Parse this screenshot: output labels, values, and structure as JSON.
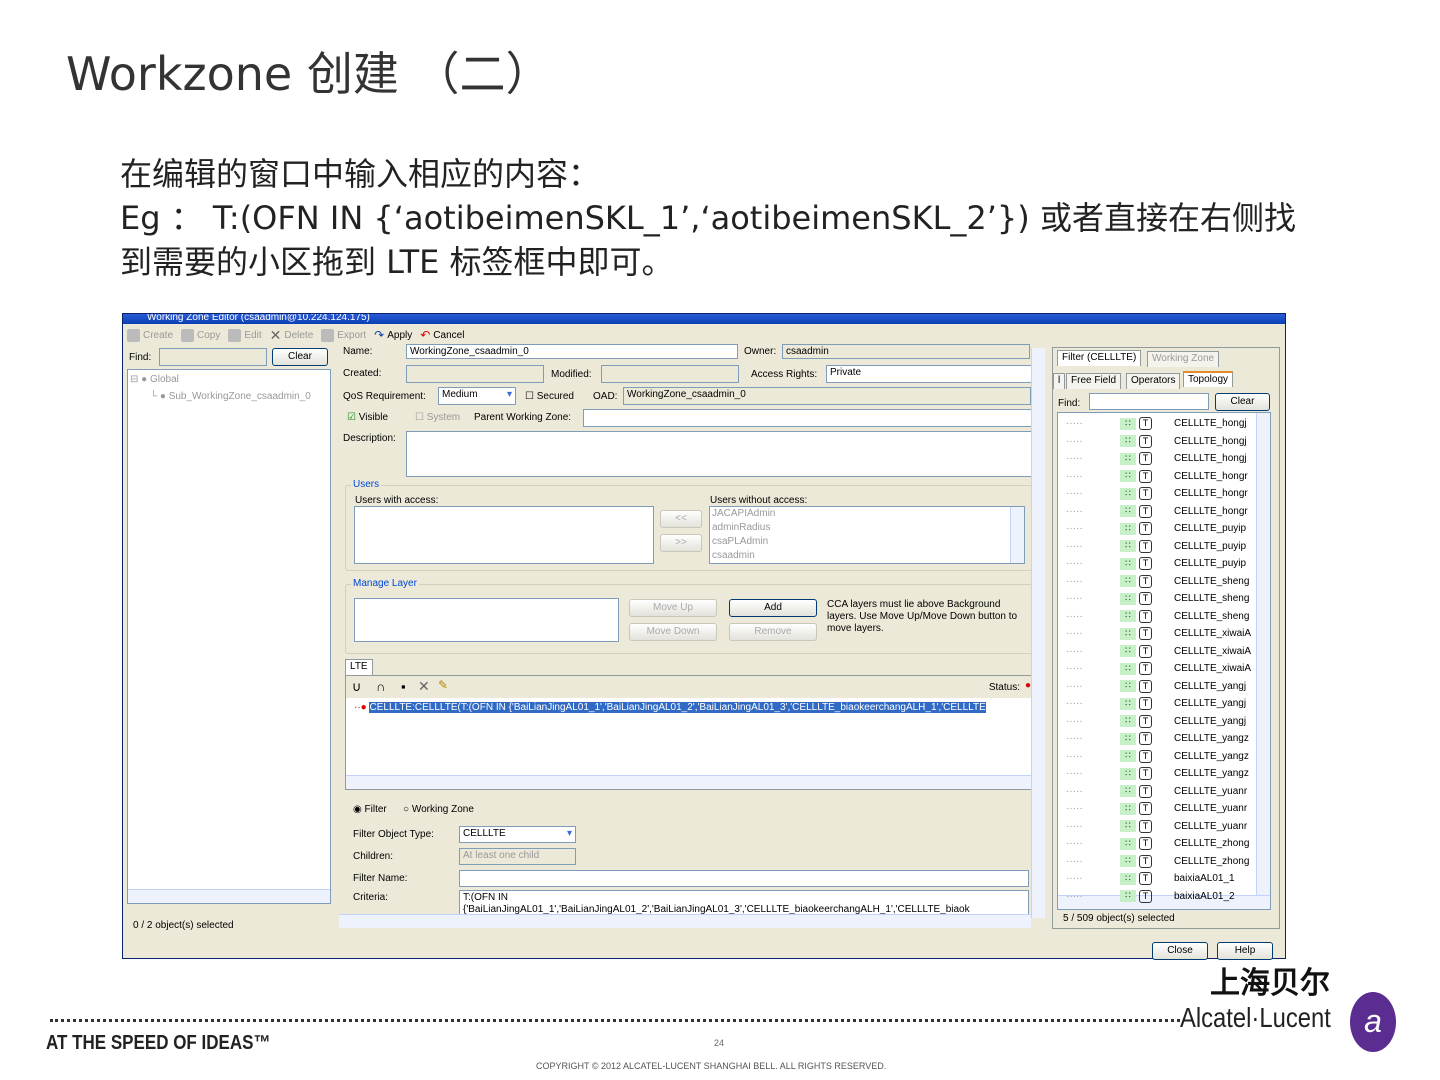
{
  "slide": {
    "title": "Workzone 创建 （二）",
    "lines": [
      "在编辑的窗口中输入相应的内容：",
      "Eg  ： T:(OFN IN {‘aotibeimenSKL_1’,‘aotibeimenSKL_2’}) 或者直接在右侧找",
      "到需要的小区拖到 LTE 标签框中即可。"
    ],
    "page_number": "24",
    "copyright": "COPYRIGHT © 2012 ALCATEL-LUCENT SHANGHAI BELL.  ALL RIGHTS RESERVED.",
    "tagline": "AT THE SPEED OF IDEAS™",
    "logo_cn": "上海贝尔",
    "logo_en": "Alcatel·Lucent"
  },
  "window": {
    "title": "Working Zone Editor (csaadmin@10.224.124.175)",
    "toolbar": [
      "Create",
      "Copy",
      "Edit",
      "Delete",
      "Export",
      "Apply",
      "Cancel"
    ],
    "left": {
      "find_label": "Find:",
      "clear": "Clear",
      "tree": [
        "Global",
        "Sub_WorkingZone_csaadmin_0"
      ],
      "status": "0 / 2 object(s) selected"
    },
    "form": {
      "name_label": "Name:",
      "name": "WorkingZone_csaadmin_0",
      "owner_label": "Owner:",
      "owner": "csaadmin",
      "created_label": "Created:",
      "modified_label": "Modified:",
      "access_label": "Access Rights:",
      "access": "Private",
      "qos_label": "QoS Requirement:",
      "qos": "Medium",
      "secured": "Secured",
      "oad_label": "OAD:",
      "oad": "WorkingZone_csaadmin_0",
      "visible": "Visible",
      "system": "System",
      "parent_label": "Parent Working Zone:",
      "desc_label": "Description:"
    },
    "users": {
      "title": "Users",
      "with": "Users with access:",
      "without": "Users without access:",
      "left_btn": "<<",
      "right_btn": ">>",
      "list": [
        "JACAPIAdmin",
        "adminRadius",
        "csaPLAdmin",
        "csaadmin"
      ]
    },
    "layer": {
      "title": "Manage Layer",
      "move_up": "Move Up",
      "move_down": "Move Down",
      "add": "Add",
      "remove": "Remove",
      "note": "CCA layers must lie above Background layers. Use Move Up/Move Down button to move layers."
    },
    "lte": {
      "tab": "LTE",
      "status": "Status:",
      "item": "CELLLTE:CELLLTE(T:(OFN IN {'BaiLianJingAL01_1','BaiLianJingAL01_2','BaiLianJingAL01_3','CELLLTE_biaokeerchangALH_1','CELLLTE"
    },
    "filter": {
      "radio_filter": "Filter",
      "radio_wz": "Working Zone",
      "type_label": "Filter Object Type:",
      "type": "CELLLTE",
      "children_label": "Children:",
      "children": "At least one child",
      "name_label": "Filter Name:",
      "criteria_label": "Criteria:",
      "criteria": "T:(OFN IN",
      "criteria2": "{'BaiLianJingAL01_1','BaiLianJingAL01_2','BaiLianJingAL01_3','CELLLTE_biaokeerchangALH_1','CELLLTE_biaok"
    },
    "right": {
      "tabs": [
        "Filter (CELLLTE)",
        "Working Zone"
      ],
      "subtabs": [
        "l",
        "Free Field",
        "Operators",
        "Topology"
      ],
      "find_label": "Find:",
      "clear": "Clear",
      "items": [
        "CELLLTE_hongj",
        "CELLLTE_hongj",
        "CELLLTE_hongj",
        "CELLLTE_hongr",
        "CELLLTE_hongr",
        "CELLLTE_hongr",
        "CELLLTE_puyip",
        "CELLLTE_puyip",
        "CELLLTE_puyip",
        "CELLLTE_sheng",
        "CELLLTE_sheng",
        "CELLLTE_sheng",
        "CELLLTE_xiwaiA",
        "CELLLTE_xiwaiA",
        "CELLLTE_xiwaiA",
        "CELLLTE_yangj",
        "CELLLTE_yangj",
        "CELLLTE_yangj",
        "CELLLTE_yangz",
        "CELLLTE_yangz",
        "CELLLTE_yangz",
        "CELLLTE_yuanr",
        "CELLLTE_yuanr",
        "CELLLTE_yuanr",
        "CELLLTE_zhong",
        "CELLLTE_zhong",
        "baixiaAL01_1",
        "baixiaAL01_2"
      ],
      "status": "5 / 509 object(s) selected"
    },
    "close": "Close",
    "help": "Help"
  }
}
